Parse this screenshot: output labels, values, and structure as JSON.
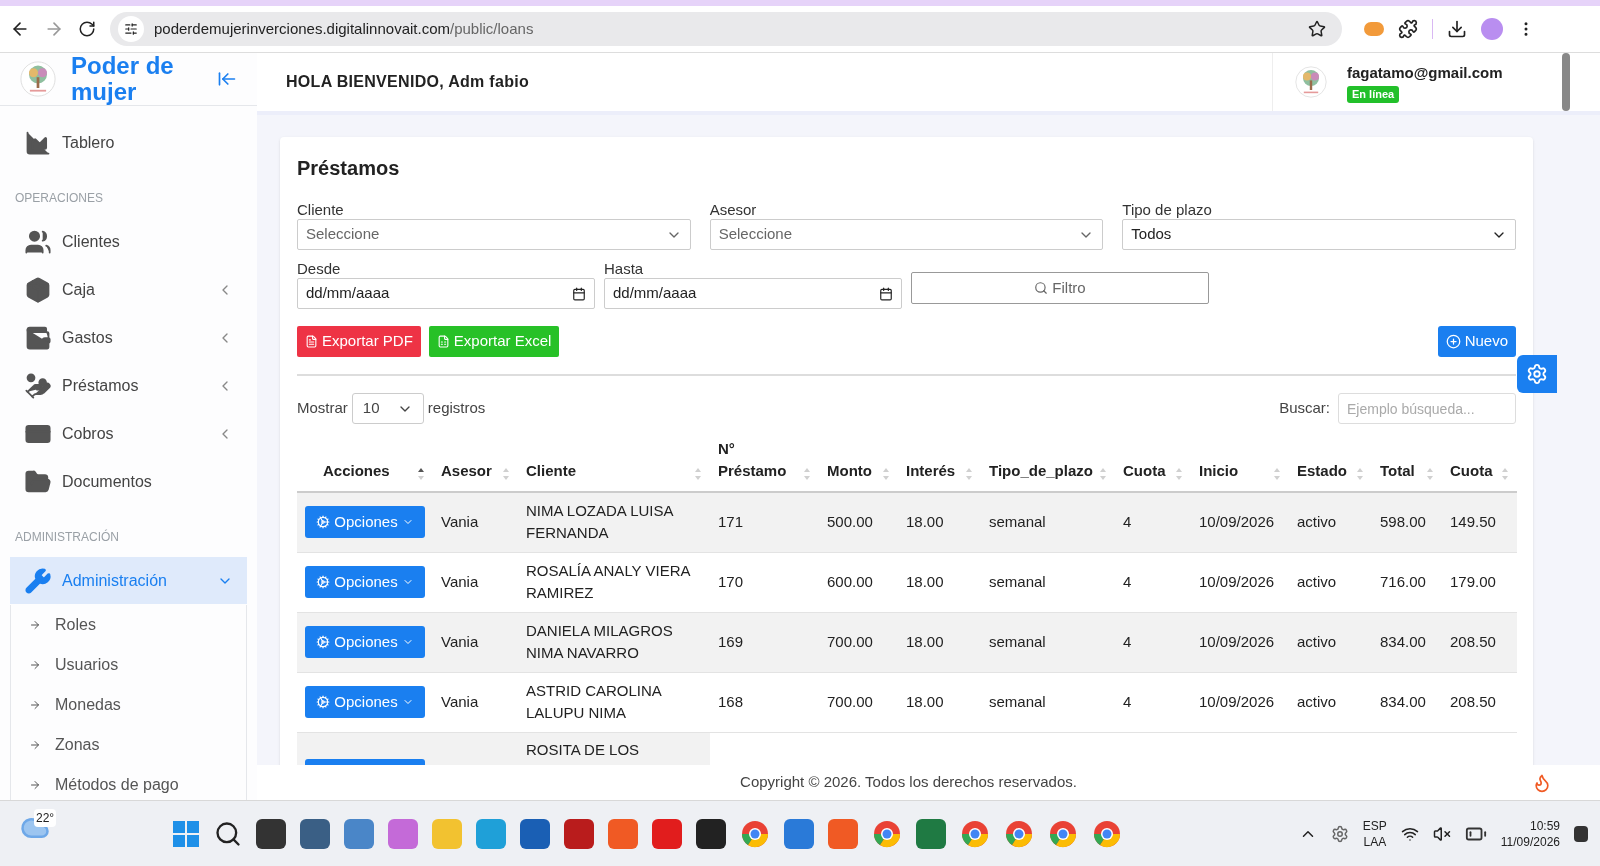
{
  "browser": {
    "url_host": "poderdemujerinverciones.digitalinnovait.com",
    "url_path": "/public/loans"
  },
  "sidebar": {
    "brand": "Poder de mujer",
    "items": [
      {
        "kind": "item",
        "label": "Tablero",
        "selected": false
      },
      {
        "kind": "heading",
        "label": "OPERACIONES"
      },
      {
        "kind": "item",
        "label": "Clientes",
        "selected": false
      },
      {
        "kind": "group",
        "label": "Caja",
        "selected": false,
        "expanded": false
      },
      {
        "kind": "group",
        "label": "Gastos",
        "selected": false,
        "expanded": false
      },
      {
        "kind": "group",
        "label": "Préstamos",
        "selected": false,
        "expanded": false
      },
      {
        "kind": "group",
        "label": "Cobros",
        "selected": false,
        "expanded": false
      },
      {
        "kind": "item",
        "label": "Documentos",
        "selected": false
      },
      {
        "kind": "heading",
        "label": "ADMINISTRACIÓN"
      },
      {
        "kind": "group",
        "label": "Administración",
        "selected": true,
        "expanded": true,
        "children": [
          {
            "label": "Roles"
          },
          {
            "label": "Usuarios"
          },
          {
            "label": "Monedas"
          },
          {
            "label": "Zonas"
          },
          {
            "label": "Métodos de pago"
          }
        ]
      }
    ]
  },
  "header": {
    "greeting": "HOLA BIENVENIDO, Adm fabio",
    "email": "fagatamo@gmail.com",
    "status": "En línea"
  },
  "page": {
    "title": "Préstamos",
    "filters": [
      {
        "label": "Cliente",
        "kind": "select",
        "placeholder": "Seleccione"
      },
      {
        "label": "Asesor",
        "kind": "select",
        "placeholder": "Seleccione"
      },
      {
        "label": "Tipo de plazo",
        "kind": "select",
        "value": "Todos"
      }
    ],
    "dates": [
      {
        "label": "Desde",
        "value": "dd/mm/aaaa"
      },
      {
        "label": "Hasta",
        "value": "dd/mm/aaaa"
      }
    ],
    "filter_button": "Filtro",
    "export_buttons": [
      {
        "label": "Exportar PDF",
        "kind": "pdf"
      },
      {
        "label": "Exportar Excel",
        "kind": "excel"
      }
    ],
    "new_button": "Nuevo",
    "show_label": "Mostrar",
    "page_size": "10",
    "records_label": "registros",
    "search_label": "Buscar:",
    "search_placeholder": "Ejemplo búsqueda..."
  },
  "table": {
    "columns": [
      {
        "label": "Acciones",
        "sorted": true
      },
      {
        "label": "Asesor",
        "sorted": false
      },
      {
        "label": "Cliente",
        "sorted": false
      },
      {
        "label": "N° Préstamo",
        "sorted": false
      },
      {
        "label": "Monto",
        "sorted": false
      },
      {
        "label": "Interés",
        "sorted": false
      },
      {
        "label": "Tipo_de_plazo",
        "sorted": false
      },
      {
        "label": "Cuota",
        "sorted": false
      },
      {
        "label": "Inicio",
        "sorted": false
      },
      {
        "label": "Estado",
        "sorted": false
      },
      {
        "label": "Total",
        "sorted": false
      },
      {
        "label": "Cuota",
        "sorted": false
      }
    ],
    "rows": [
      {
        "kind": "full",
        "cells": [
          "Opciones",
          "Vania",
          "NIMA LOZADA LUISA FERNANDA",
          "171",
          "500.00",
          "18.00",
          "semanal",
          "4",
          "10/09/2026",
          "activo",
          "598.00",
          "149.50"
        ]
      },
      {
        "kind": "full",
        "cells": [
          "Opciones",
          "Vania",
          "ROSALÍA ANALY VIERA RAMIREZ",
          "170",
          "600.00",
          "18.00",
          "semanal",
          "4",
          "10/09/2026",
          "activo",
          "716.00",
          "179.00"
        ]
      },
      {
        "kind": "full",
        "cells": [
          "Opciones",
          "Vania",
          "DANIELA MILAGROS NIMA NAVARRO",
          "169",
          "700.00",
          "18.00",
          "semanal",
          "4",
          "10/09/2026",
          "activo",
          "834.00",
          "208.50"
        ]
      },
      {
        "kind": "full",
        "cells": [
          "Opciones",
          "Vania",
          "ASTRID CAROLINA LALUPU NIMA",
          "168",
          "700.00",
          "18.00",
          "semanal",
          "4",
          "10/09/2026",
          "activo",
          "834.00",
          "208.50"
        ]
      },
      {
        "kind": "cut",
        "cells": [
          "",
          "",
          "ROSITA DE LOS"
        ]
      }
    ]
  },
  "footer": "Copyright © 2026. Todos los derechos reservados.",
  "taskbar": {
    "weather": "22°",
    "language": "ESP",
    "layout": "LAA",
    "time": "10:59",
    "date": "11/09/2026"
  }
}
